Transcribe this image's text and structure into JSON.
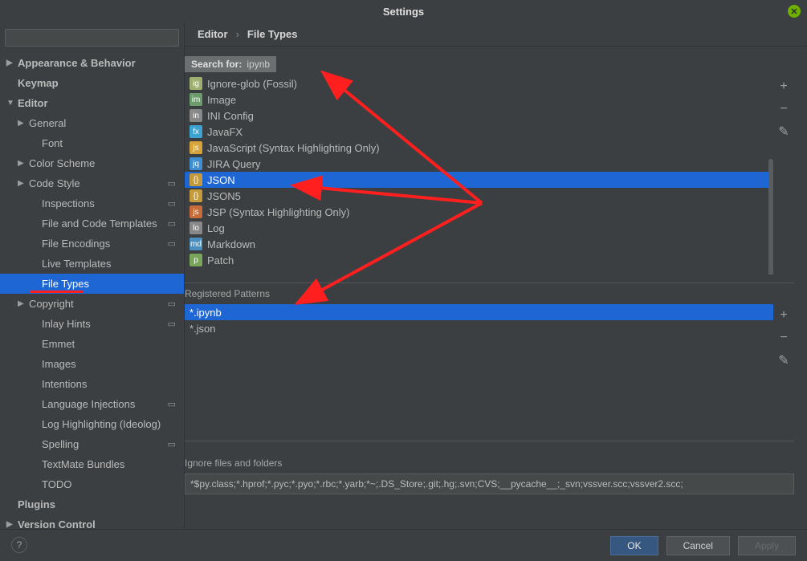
{
  "window": {
    "title": "Settings"
  },
  "sidebar": {
    "search_placeholder": "",
    "items": [
      {
        "label": "Appearance & Behavior",
        "level": 0,
        "arrow": "▶",
        "bold": true
      },
      {
        "label": "Keymap",
        "level": 0,
        "bold": true
      },
      {
        "label": "Editor",
        "level": 0,
        "arrow": "▼",
        "bold": true
      },
      {
        "label": "General",
        "level": 1,
        "arrow": "▶"
      },
      {
        "label": "Font",
        "level": 2
      },
      {
        "label": "Color Scheme",
        "level": 1,
        "arrow": "▶"
      },
      {
        "label": "Code Style",
        "level": 1,
        "arrow": "▶",
        "scope": true
      },
      {
        "label": "Inspections",
        "level": 2,
        "scope": true
      },
      {
        "label": "File and Code Templates",
        "level": 2,
        "scope": true
      },
      {
        "label": "File Encodings",
        "level": 2,
        "scope": true
      },
      {
        "label": "Live Templates",
        "level": 2
      },
      {
        "label": "File Types",
        "level": 2,
        "selected": true,
        "underline": true
      },
      {
        "label": "Copyright",
        "level": 1,
        "arrow": "▶",
        "scope": true
      },
      {
        "label": "Inlay Hints",
        "level": 2,
        "scope": true
      },
      {
        "label": "Emmet",
        "level": 2
      },
      {
        "label": "Images",
        "level": 2
      },
      {
        "label": "Intentions",
        "level": 2
      },
      {
        "label": "Language Injections",
        "level": 2,
        "scope": true
      },
      {
        "label": "Log Highlighting (Ideolog)",
        "level": 2
      },
      {
        "label": "Spelling",
        "level": 2,
        "scope": true
      },
      {
        "label": "TextMate Bundles",
        "level": 2
      },
      {
        "label": "TODO",
        "level": 2
      },
      {
        "label": "Plugins",
        "level": 0,
        "bold": true
      },
      {
        "label": "Version Control",
        "level": 0,
        "arrow": "▶",
        "bold": true
      }
    ]
  },
  "breadcrumb": {
    "a": "Editor",
    "sep": "›",
    "b": "File Types"
  },
  "searchfor": {
    "label": "Search for:",
    "value": "ipynb"
  },
  "filetypes": [
    {
      "label": "Ignore-glob (Fossil)",
      "icon": "ig",
      "color": "#a0b070"
    },
    {
      "label": "Image",
      "icon": "img",
      "color": "#6b9d6b"
    },
    {
      "label": "INI Config",
      "icon": "ini",
      "color": "#888"
    },
    {
      "label": "JavaFX",
      "icon": "fx",
      "color": "#3fa3d1"
    },
    {
      "label": "JavaScript (Syntax Highlighting Only)",
      "icon": "js",
      "color": "#d7a43c"
    },
    {
      "label": "JIRA Query",
      "icon": "jq",
      "color": "#3f8dd1"
    },
    {
      "label": "JSON",
      "icon": "{}",
      "color": "#c49a3a",
      "selected": true
    },
    {
      "label": "JSON5",
      "icon": "{}",
      "color": "#c49a3a"
    },
    {
      "label": "JSP (Syntax Highlighting Only)",
      "icon": "jsp",
      "color": "#c76b3a"
    },
    {
      "label": "Log",
      "icon": "log",
      "color": "#888"
    },
    {
      "label": "Markdown",
      "icon": "md",
      "color": "#4a8fbf"
    },
    {
      "label": "Patch",
      "icon": "p",
      "color": "#7aa65b"
    }
  ],
  "registered_patterns": {
    "label": "Registered Patterns",
    "rows": [
      {
        "label": "*.ipynb",
        "selected": true
      },
      {
        "label": "*.json"
      }
    ]
  },
  "ignore": {
    "label": "Ignore files and folders",
    "value": "*$py.class;*.hprof;*.pyc;*.pyo;*.rbc;*.yarb;*~;.DS_Store;.git;.hg;.svn;CVS;__pycache__;_svn;vssver.scc;vssver2.scc;"
  },
  "footer": {
    "ok": "OK",
    "cancel": "Cancel",
    "apply": "Apply"
  }
}
